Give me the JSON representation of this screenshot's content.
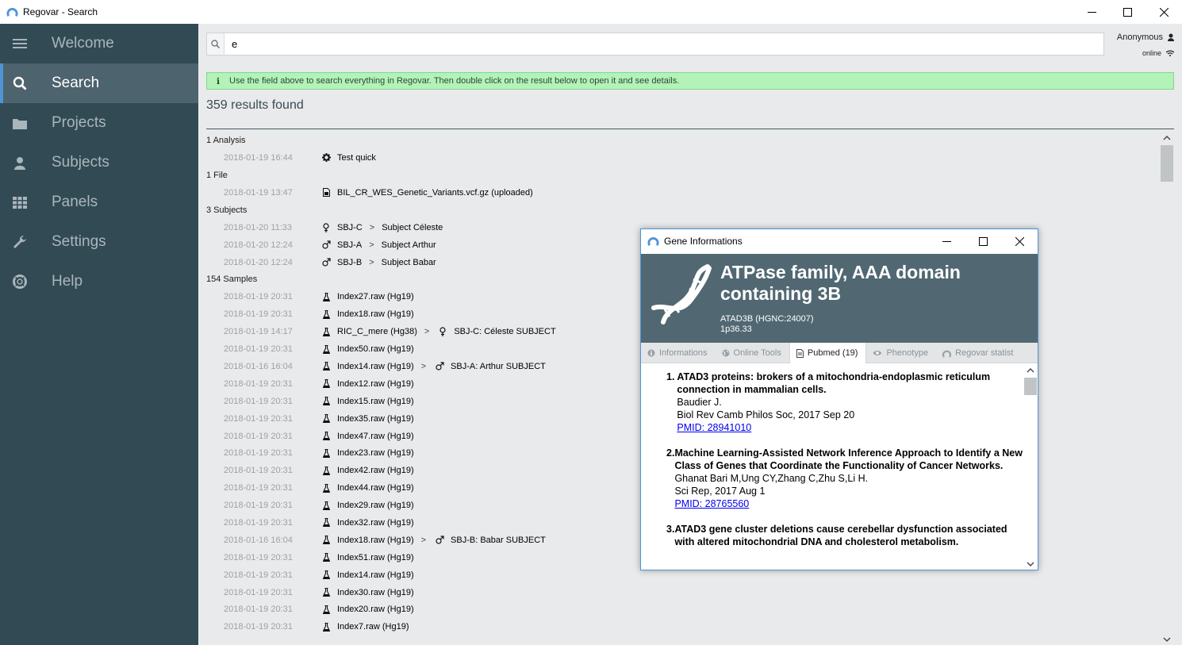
{
  "window": {
    "title": "Regovar - Search"
  },
  "sidebar": {
    "items": [
      {
        "label": "Welcome",
        "icon": "menu-icon"
      },
      {
        "label": "Search",
        "icon": "search-icon",
        "active": true
      },
      {
        "label": "Projects",
        "icon": "folder-icon"
      },
      {
        "label": "Subjects",
        "icon": "user-icon"
      },
      {
        "label": "Panels",
        "icon": "grid-icon"
      },
      {
        "label": "Settings",
        "icon": "wrench-icon"
      },
      {
        "label": "Help",
        "icon": "lifebuoy-icon"
      }
    ]
  },
  "search": {
    "value": "e"
  },
  "user": {
    "name": "Anonymous",
    "status": "online"
  },
  "info": {
    "text": "Use the field above to search everything in Regovar. Then double click on the result below to open it and see details."
  },
  "results": {
    "count_label": "359 results found",
    "groups": [
      {
        "header": "1 Analysis",
        "items": [
          {
            "date": "2018-01-19 16:44",
            "icon": "gear-icon",
            "name": "Test quick"
          }
        ]
      },
      {
        "header": "1 File",
        "items": [
          {
            "date": "2018-01-19 13:47",
            "icon": "file-icon",
            "name": "BIL_CR_WES_Genetic_Variants.vcf.gz (uploaded)"
          }
        ]
      },
      {
        "header": "3 Subjects",
        "items": [
          {
            "date": "2018-01-20 11:33",
            "icon": "female-icon",
            "name": "SBJ-C",
            "sep": ">",
            "extra": "Subject Céleste"
          },
          {
            "date": "2018-01-20 12:24",
            "icon": "male-icon",
            "name": "SBJ-A",
            "sep": ">",
            "extra": "Subject Arthur"
          },
          {
            "date": "2018-01-20 12:24",
            "icon": "male-icon",
            "name": "SBJ-B",
            "sep": ">",
            "extra": "Subject Babar"
          }
        ]
      },
      {
        "header": "154 Samples",
        "items": [
          {
            "date": "2018-01-19 20:31",
            "icon": "flask-icon",
            "name": "Index27.raw (Hg19)"
          },
          {
            "date": "2018-01-19 20:31",
            "icon": "flask-icon",
            "name": "Index18.raw (Hg19)"
          },
          {
            "date": "2018-01-19 14:17",
            "icon": "flask-icon",
            "name": "RIC_C_mere (Hg38)",
            "sep": ">",
            "extra_icon": "female-icon",
            "extra": "SBJ-C: Céleste SUBJECT"
          },
          {
            "date": "2018-01-19 20:31",
            "icon": "flask-icon",
            "name": "Index50.raw (Hg19)"
          },
          {
            "date": "2018-01-16 16:04",
            "icon": "flask-icon",
            "name": "Index14.raw (Hg19)",
            "sep": ">",
            "extra_icon": "male-icon",
            "extra": "SBJ-A: Arthur SUBJECT"
          },
          {
            "date": "2018-01-19 20:31",
            "icon": "flask-icon",
            "name": "Index12.raw (Hg19)"
          },
          {
            "date": "2018-01-19 20:31",
            "icon": "flask-icon",
            "name": "Index15.raw (Hg19)"
          },
          {
            "date": "2018-01-19 20:31",
            "icon": "flask-icon",
            "name": "Index35.raw (Hg19)"
          },
          {
            "date": "2018-01-19 20:31",
            "icon": "flask-icon",
            "name": "Index47.raw (Hg19)"
          },
          {
            "date": "2018-01-19 20:31",
            "icon": "flask-icon",
            "name": "Index23.raw (Hg19)"
          },
          {
            "date": "2018-01-19 20:31",
            "icon": "flask-icon",
            "name": "Index42.raw (Hg19)"
          },
          {
            "date": "2018-01-19 20:31",
            "icon": "flask-icon",
            "name": "Index44.raw (Hg19)"
          },
          {
            "date": "2018-01-19 20:31",
            "icon": "flask-icon",
            "name": "Index29.raw (Hg19)"
          },
          {
            "date": "2018-01-19 20:31",
            "icon": "flask-icon",
            "name": "Index32.raw (Hg19)"
          },
          {
            "date": "2018-01-16 16:04",
            "icon": "flask-icon",
            "name": "Index18.raw (Hg19)",
            "sep": ">",
            "extra_icon": "male-icon",
            "extra": "SBJ-B: Babar SUBJECT"
          },
          {
            "date": "2018-01-19 20:31",
            "icon": "flask-icon",
            "name": "Index51.raw (Hg19)"
          },
          {
            "date": "2018-01-19 20:31",
            "icon": "flask-icon",
            "name": "Index14.raw (Hg19)"
          },
          {
            "date": "2018-01-19 20:31",
            "icon": "flask-icon",
            "name": "Index30.raw (Hg19)"
          },
          {
            "date": "2018-01-19 20:31",
            "icon": "flask-icon",
            "name": "Index20.raw (Hg19)"
          },
          {
            "date": "2018-01-19 20:31",
            "icon": "flask-icon",
            "name": "Index7.raw (Hg19)"
          }
        ]
      }
    ]
  },
  "dialog": {
    "title": "Gene Informations",
    "gene_name": "ATPase family, AAA domain containing 3B",
    "gene_symbol": "ATAD3B (HGNC:24007)",
    "locus": "1p36.33",
    "tabs": [
      {
        "label": "Informations",
        "icon": "info-icon"
      },
      {
        "label": "Online Tools",
        "icon": "globe-icon"
      },
      {
        "label": "Pubmed (19)",
        "icon": "document-icon",
        "active": true
      },
      {
        "label": "Phenotype",
        "icon": "eye-icon"
      },
      {
        "label": "Regovar statist",
        "icon": "regovar-icon"
      }
    ],
    "publications": [
      {
        "num": "1.",
        "title": "ATAD3 proteins: brokers of a mitochondria-endoplasmic reticulum connection in mammalian cells.",
        "authors": "Baudier J.",
        "journal": "Biol Rev Camb Philos Soc, 2017 Sep 20",
        "pmid": "PMID: 28941010"
      },
      {
        "num": "2.",
        "title": "Machine Learning-Assisted Network Inference Approach to Identify a New Class of Genes that Coordinate the Functionality of Cancer Networks.",
        "authors": "Ghanat Bari M,Ung CY,Zhang C,Zhu S,Li H.",
        "journal": "Sci Rep, 2017 Aug 1",
        "pmid": "PMID: 28765560"
      },
      {
        "num": "3.",
        "title": "ATAD3 gene cluster deletions cause cerebellar dysfunction associated with altered mitochondrial DNA and cholesterol metabolism.",
        "authors": "",
        "journal": "",
        "pmid": ""
      }
    ]
  },
  "colors": {
    "sidebar_bg": "#324a54",
    "sidebar_active": "#4d636d",
    "accent": "#4f94d4",
    "info_bg": "#b3f2b8",
    "gene_header_bg": "#516873"
  }
}
